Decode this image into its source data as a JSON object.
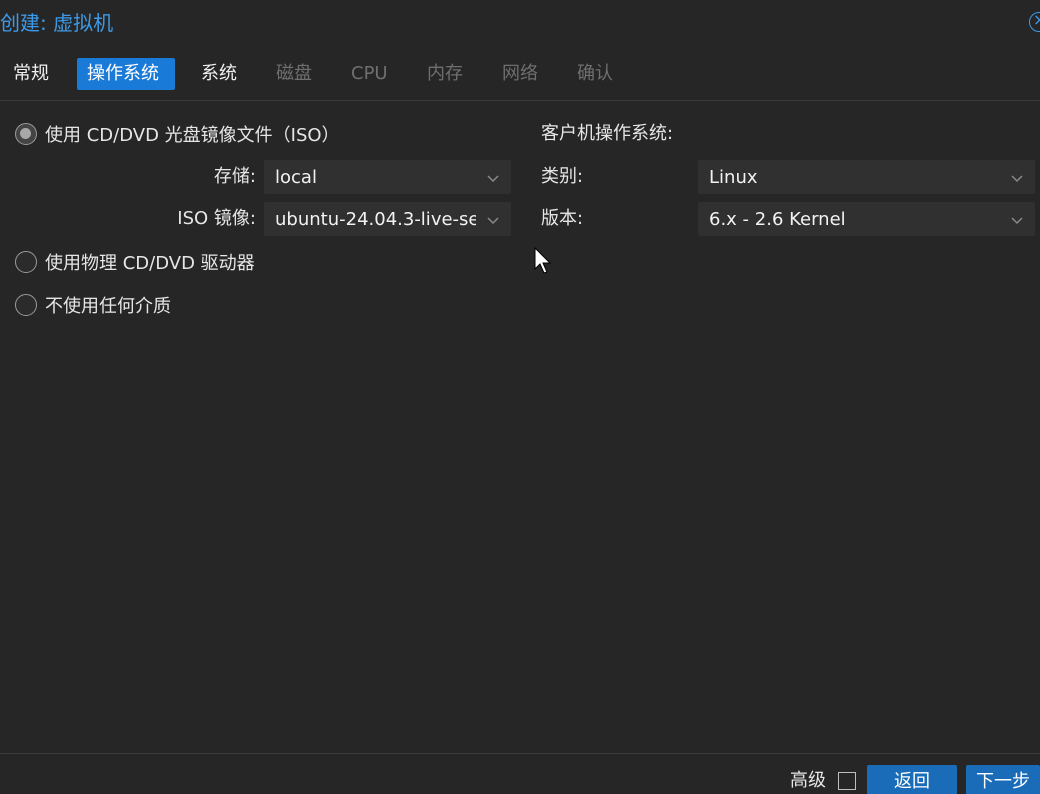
{
  "window": {
    "title": "创建: 虚拟机"
  },
  "tabs": [
    {
      "label": "常规",
      "state": "enabled"
    },
    {
      "label": "操作系统",
      "state": "active"
    },
    {
      "label": "系统",
      "state": "enabled"
    },
    {
      "label": "磁盘",
      "state": "disabled"
    },
    {
      "label": "CPU",
      "state": "disabled"
    },
    {
      "label": "内存",
      "state": "disabled"
    },
    {
      "label": "网络",
      "state": "disabled"
    },
    {
      "label": "确认",
      "state": "disabled"
    }
  ],
  "media": {
    "option_iso": "使用 CD/DVD 光盘镜像文件（ISO）",
    "option_physical": "使用物理 CD/DVD 驱动器",
    "option_none": "不使用任何介质",
    "selected": "option_iso",
    "storage_label": "存储:",
    "storage_value": "local",
    "iso_label": "ISO 镜像:",
    "iso_value": "ubuntu-24.04.3-live-se"
  },
  "guest_os": {
    "heading": "客户机操作系统:",
    "type_label": "类别:",
    "type_value": "Linux",
    "version_label": "版本:",
    "version_value": "6.x - 2.6 Kernel"
  },
  "footer": {
    "advanced_label": "高级",
    "advanced_checked": false,
    "back_label": "返回",
    "next_label": "下一步"
  },
  "colors": {
    "background": "#262626",
    "accent": "#1a7ad8",
    "title": "#3d9ae8",
    "button": "#1a6cb8"
  }
}
